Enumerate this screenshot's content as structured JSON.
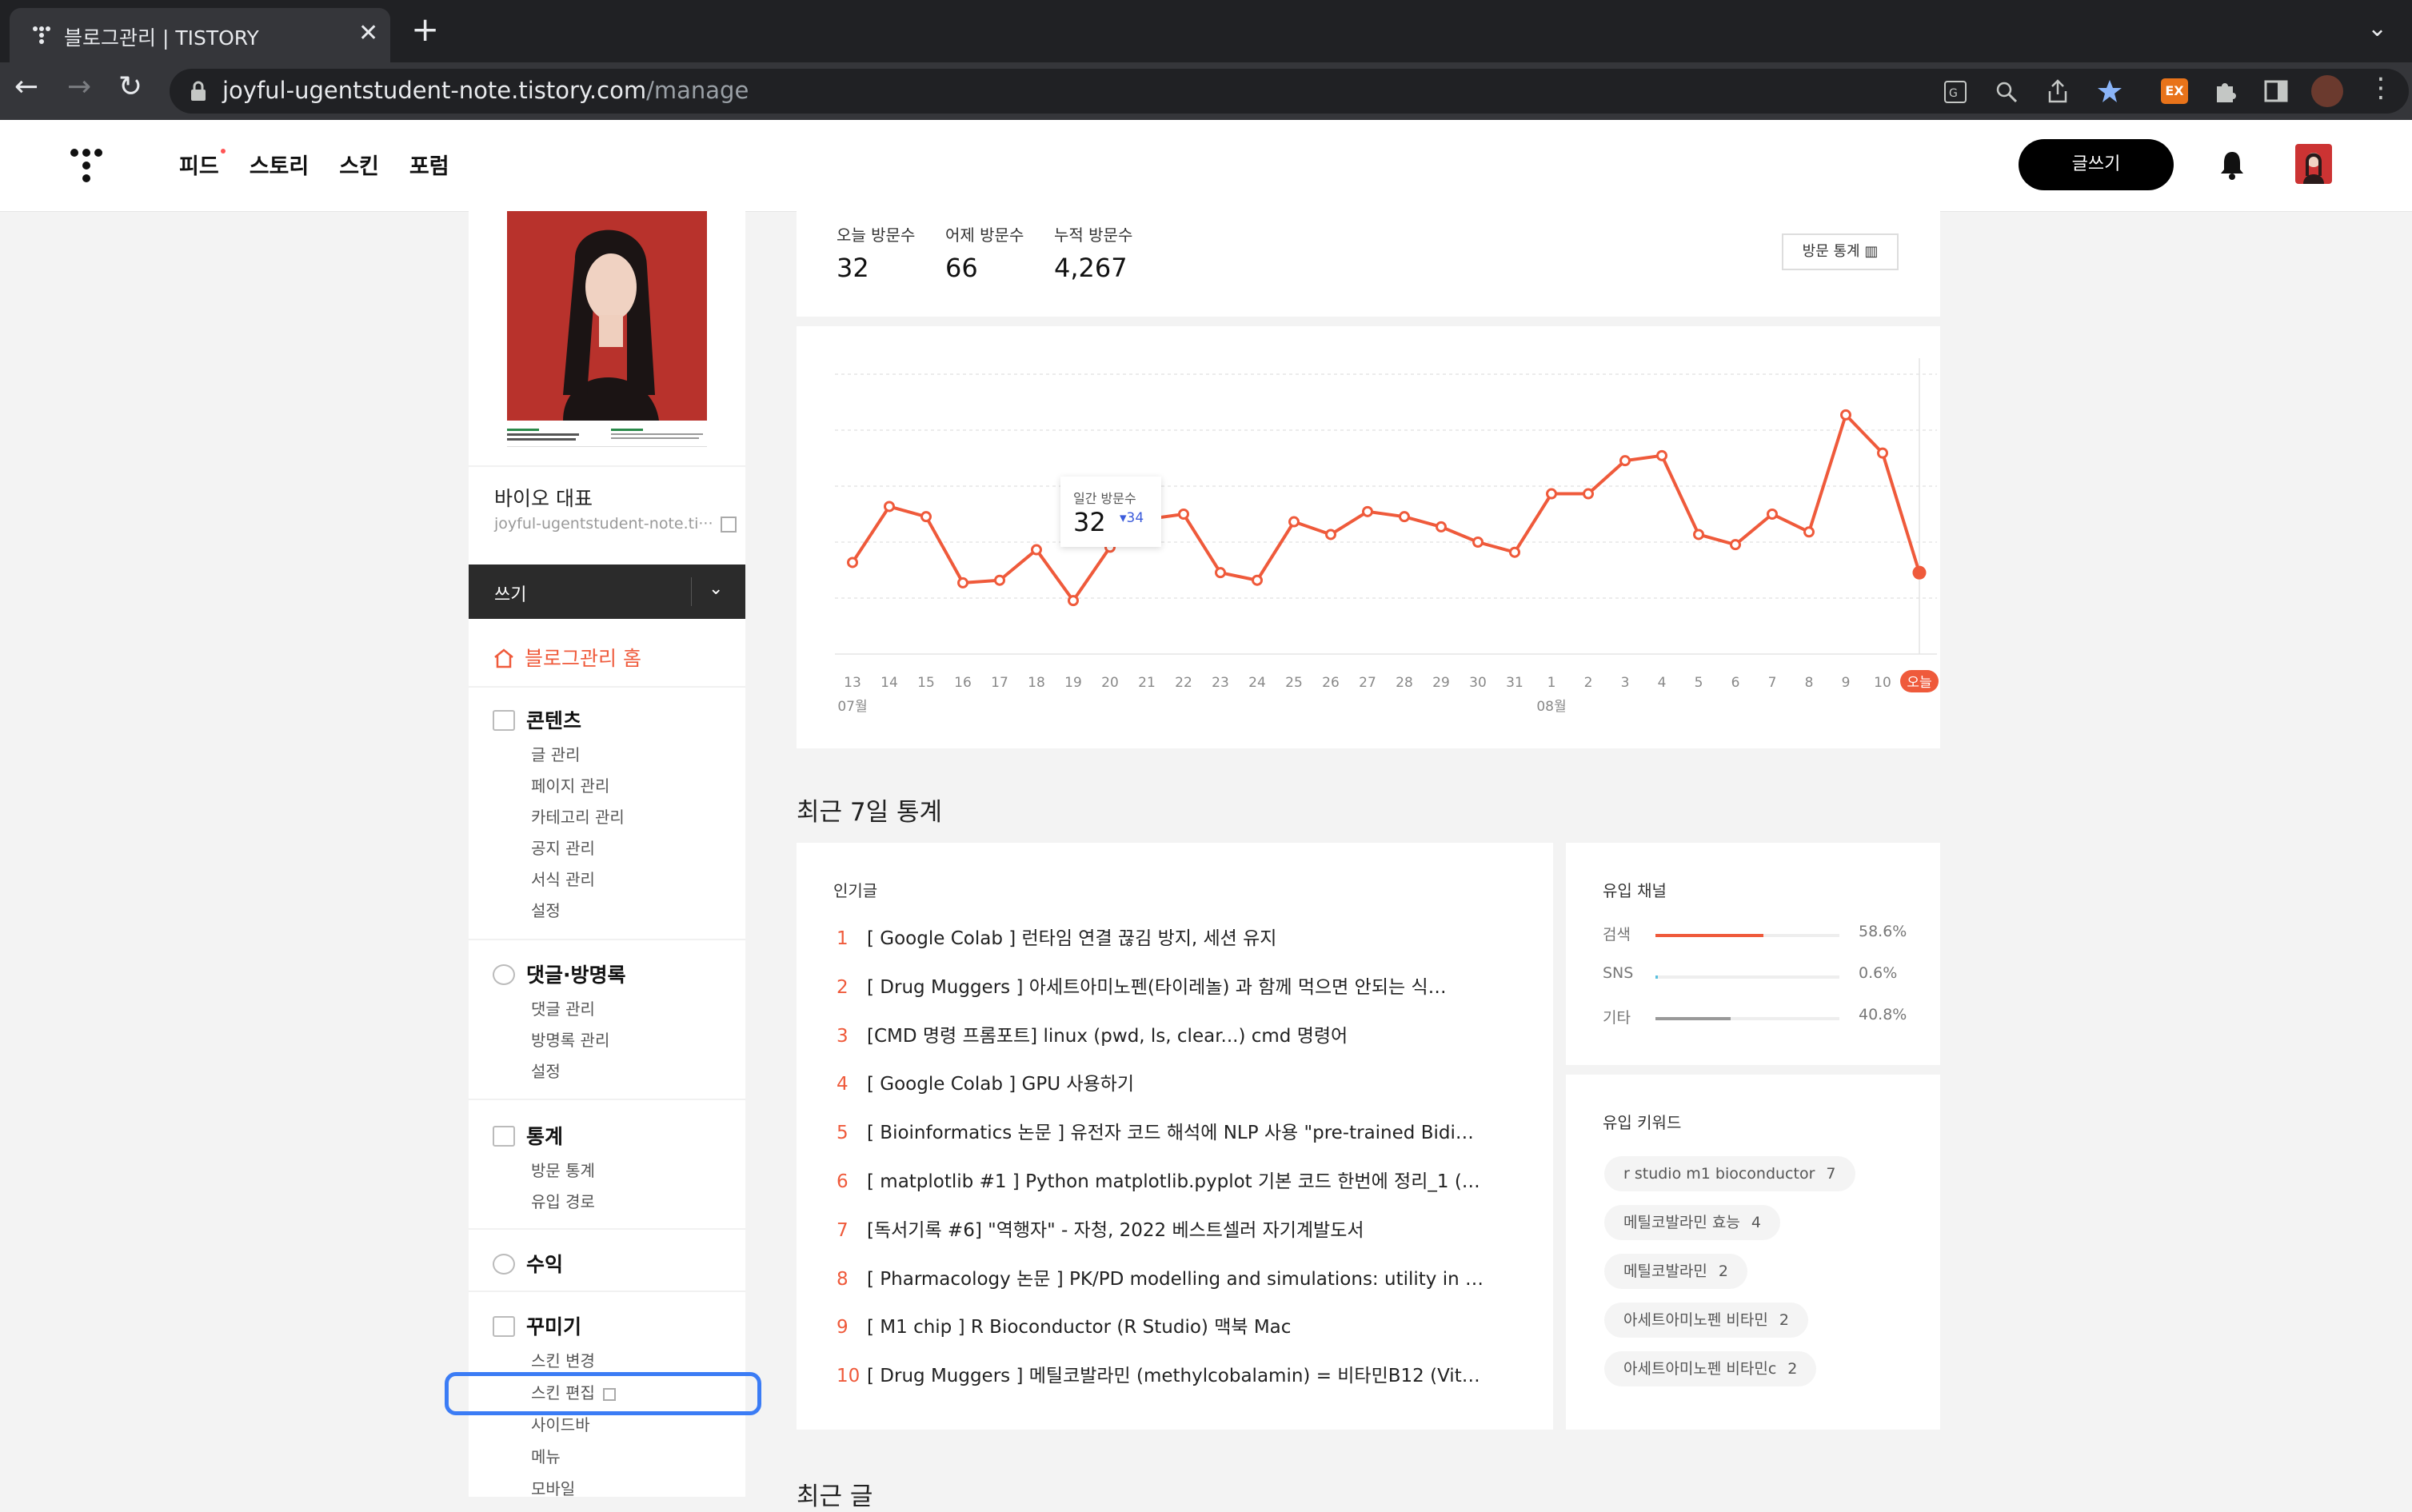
{
  "browser": {
    "tab_title": "블로그관리 | TISTORY",
    "tab_close": "✕",
    "new_tab": "+",
    "tab_menu": "⌄",
    "back": "←",
    "forward": "→",
    "reload": "↻",
    "url_host": "joyful-ugentstudent-note.tistory.com",
    "url_path": "/manage",
    "ext_badge": "EX"
  },
  "header": {
    "nav": [
      "피드",
      "스토리",
      "스킨",
      "포럼"
    ],
    "write_button": "글쓰기"
  },
  "sidebar": {
    "blog_name": "바이오 대표",
    "blog_url": "joyful-ugentstudent-note.ti···",
    "write_label": "쓰기",
    "home": "블로그관리 홈",
    "sections": [
      {
        "title": "콘텐츠",
        "items": [
          "글 관리",
          "페이지 관리",
          "카테고리 관리",
          "공지 관리",
          "서식 관리",
          "설정"
        ]
      },
      {
        "title": "댓글·방명록",
        "items": [
          "댓글 관리",
          "방명록 관리",
          "설정"
        ]
      },
      {
        "title": "통계",
        "items": [
          "방문 통계",
          "유입 경로"
        ]
      },
      {
        "title": "수익",
        "items": []
      },
      {
        "title": "꾸미기",
        "items": [
          "스킨 변경",
          "스킨 편집",
          "사이드바",
          "메뉴",
          "모바일"
        ]
      }
    ]
  },
  "stats": {
    "today_label": "오늘 방문수",
    "today": "32",
    "yesterday_label": "어제 방문수",
    "yesterday": "66",
    "total_label": "누적 방문수",
    "total": "4,267",
    "visit_button": "방문 통계"
  },
  "chart_data": {
    "type": "line",
    "x": [
      "13",
      "14",
      "15",
      "16",
      "17",
      "18",
      "19",
      "20",
      "21",
      "22",
      "23",
      "24",
      "25",
      "26",
      "27",
      "28",
      "29",
      "30",
      "31",
      "1",
      "2",
      "3",
      "4",
      "5",
      "6",
      "7",
      "8",
      "9",
      "10",
      "오늘"
    ],
    "month_labels": [
      {
        "label": "07월",
        "at": "13"
      },
      {
        "label": "08월",
        "at": "1"
      }
    ],
    "series": [
      {
        "values": [
          36,
          58,
          54,
          28,
          29,
          41,
          21,
          42,
          53,
          55,
          32,
          29,
          52,
          47,
          56,
          54,
          50,
          44,
          40,
          63,
          63,
          76,
          78,
          47,
          43,
          55,
          48,
          94,
          79,
          32
        ]
      }
    ],
    "tooltip": {
      "label": "일간 방문수",
      "value": "32",
      "change": "▾34"
    },
    "ylim": [
      0,
      110
    ],
    "grid": true,
    "color": "#ef5a3b"
  },
  "recent7": {
    "title": "최근 7일 통계",
    "popular_title": "인기글",
    "popular": [
      "[ Google Colab ] 런타임 연결 끊김 방지, 세션 유지",
      "[ Drug Muggers ] 아세트아미노펜(타이레놀) 과 함께 먹으면 안되는 식…",
      "[CMD 명령 프롬포트] linux (pwd, ls, clear...) cmd 명령어",
      "[ Google Colab ] GPU 사용하기",
      "[ Bioinformatics 논문 ] 유전자 코드 해석에 NLP 사용 \"pre-trained Bidi…",
      "[ matplotlib #1 ] Python matplotlib.pyplot 기본 코드 한번에 정리_1 (…",
      "[독서기록 #6] \"역행자\" - 자청, 2022 베스트셀러 자기계발도서",
      "[ Pharmacology 논문 ] PK/PD modelling and simulations: utility in …",
      "[ M1 chip ] R Bioconductor (R Studio) 맥북 Mac",
      "[ Drug Muggers ] 메틸코발라민 (methylcobalamin) = 비타민B12 (Vit…"
    ],
    "channel_title": "유입 채널",
    "channels": [
      {
        "label": "검색",
        "pct": "58.6%",
        "value": 58.6,
        "color": "#ef5a3b"
      },
      {
        "label": "SNS",
        "pct": "0.6%",
        "value": 0.6,
        "color": "#5bc0de"
      },
      {
        "label": "기타",
        "pct": "40.8%",
        "value": 40.8,
        "color": "#999999"
      }
    ],
    "keyword_title": "유입 키워드",
    "keywords": [
      {
        "text": "r studio m1 bioconductor",
        "count": "7"
      },
      {
        "text": "메틸코발라민 효능",
        "count": "4"
      },
      {
        "text": "메틸코발라민",
        "count": "2"
      },
      {
        "text": "아세트아미노펜 비타민",
        "count": "2"
      },
      {
        "text": "아세트아미노펜 비타민c",
        "count": "2"
      }
    ]
  },
  "recent_posts_title": "최근 글"
}
